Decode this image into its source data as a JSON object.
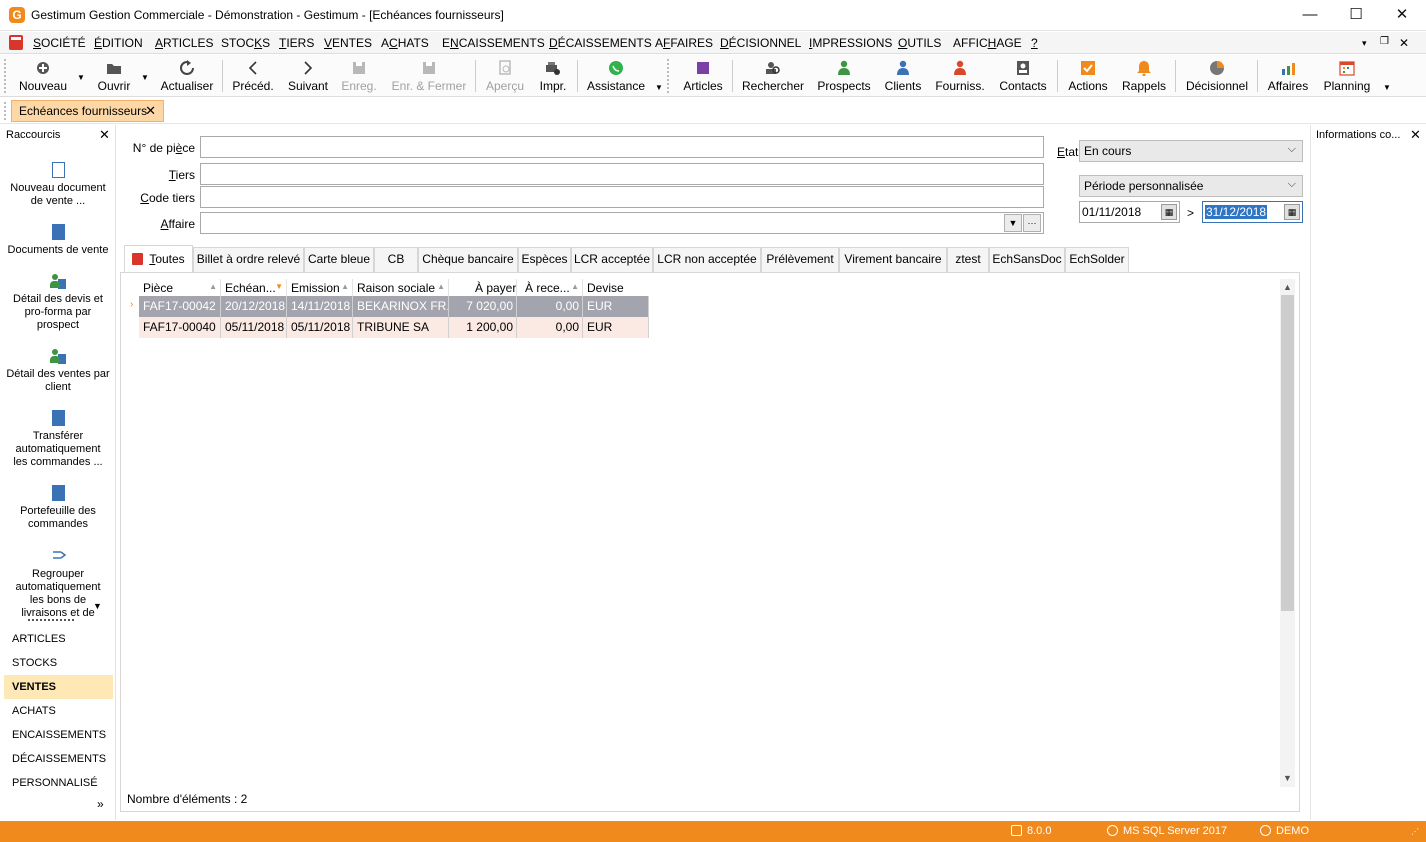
{
  "window": {
    "logo_letter": "G",
    "title": "Gestimum Gestion Commerciale - Démonstration - Gestimum - [Echéances fournisseurs]",
    "minimize": "—",
    "maximize": "☐",
    "close": "✕"
  },
  "menu": [
    {
      "pre": "",
      "u": "S",
      "post": "OCIÉTÉ"
    },
    {
      "pre": "",
      "u": "É",
      "post": "DITION"
    },
    {
      "pre": "",
      "u": "A",
      "post": "RTICLES"
    },
    {
      "pre": "STOC",
      "u": "K",
      "post": "S"
    },
    {
      "pre": "",
      "u": "T",
      "post": "IERS"
    },
    {
      "pre": "",
      "u": "V",
      "post": "ENTES"
    },
    {
      "pre": "A",
      "u": "C",
      "post": "HATS"
    },
    {
      "pre": "E",
      "u": "N",
      "post": "CAISSEMENTS"
    },
    {
      "pre": "",
      "u": "D",
      "post": "ÉCAISSEMENTS"
    },
    {
      "pre": "A",
      "u": "F",
      "post": "FAIRES"
    },
    {
      "pre": "",
      "u": "D",
      "post": "ÉCISIONNEL"
    },
    {
      "pre": "",
      "u": "I",
      "post": "MPRESSIONS"
    },
    {
      "pre": "",
      "u": "O",
      "post": "UTILS"
    },
    {
      "pre": "AFFIC",
      "u": "H",
      "post": "AGE"
    },
    {
      "pre": "",
      "u": "?",
      "post": ""
    }
  ],
  "toolbar": {
    "nouveau": "Nouveau",
    "ouvrir": "Ouvrir",
    "actualiser": "Actualiser",
    "preced": "Précéd.",
    "suivant": "Suivant",
    "enreg": "Enreg.",
    "enr_fermer": "Enr. & Fermer",
    "apercu": "Aperçu",
    "impr": "Impr.",
    "assistance": "Assistance",
    "articles": "Articles",
    "rechercher": "Rechercher",
    "prospects": "Prospects",
    "clients": "Clients",
    "fourniss": "Fourniss.",
    "contacts": "Contacts",
    "actions": "Actions",
    "rappels": "Rappels",
    "decisionnel": "Décisionnel",
    "affaires": "Affaires",
    "planning": "Planning"
  },
  "doc_tab": {
    "label": "Echéances fournisseurs",
    "close": "✕"
  },
  "sidebar": {
    "title": "Raccourcis",
    "close": "✕",
    "shortcuts": [
      "Nouveau document de vente ...",
      "Documents de vente",
      "Détail des devis et pro-forma par prospect",
      "Détail des ventes par client",
      "Transférer automatiquement les commandes ...",
      "Portefeuille des commandes",
      "Regrouper automatiquement les bons de livraisons et de"
    ],
    "categories": [
      "ARTICLES",
      "STOCKS",
      "VENTES",
      "ACHATS",
      "ENCAISSEMENTS",
      "DÉCAISSEMENTS",
      "PERSONNALISÉ"
    ],
    "active_category": "VENTES",
    "expand": "»"
  },
  "right_panel": {
    "title": "Informations co...",
    "close": "✕"
  },
  "form": {
    "num_piece_label": {
      "pre": "N° de pi",
      "u": "è",
      "post": "ce"
    },
    "tiers_label": {
      "pre": "",
      "u": "T",
      "post": "iers"
    },
    "code_tiers_label": {
      "pre": "",
      "u": "C",
      "post": "ode tiers"
    },
    "affaire_label": {
      "pre": "",
      "u": "A",
      "post": "ffaire"
    },
    "num_piece": "",
    "tiers": "",
    "code_tiers": "",
    "affaire": "",
    "etat_label": {
      "pre": "",
      "u": "E",
      "post": "tat"
    },
    "etat": "En cours",
    "periode": "Période personnalisée",
    "date_from": "01/11/2018",
    "date_sep": ">",
    "date_to": "31/12/2018"
  },
  "tabs": [
    {
      "pre": "",
      "u": "T",
      "post": "outes"
    },
    {
      "pre": "Billet à ordre relevé",
      "u": "",
      "post": ""
    },
    {
      "pre": "Carte bleue",
      "u": "",
      "post": ""
    },
    {
      "pre": "CB",
      "u": "",
      "post": ""
    },
    {
      "pre": "Chèque bancaire",
      "u": "",
      "post": ""
    },
    {
      "pre": "Espèces",
      "u": "",
      "post": ""
    },
    {
      "pre": "LCR acceptée",
      "u": "",
      "post": ""
    },
    {
      "pre": "LCR non acceptée",
      "u": "",
      "post": ""
    },
    {
      "pre": "Prélèvement",
      "u": "",
      "post": ""
    },
    {
      "pre": "Virement bancaire",
      "u": "",
      "post": ""
    },
    {
      "pre": "ztest",
      "u": "",
      "post": ""
    },
    {
      "pre": "EchSansDoc",
      "u": "",
      "post": ""
    },
    {
      "pre": "EchSolder",
      "u": "",
      "post": ""
    }
  ],
  "grid": {
    "columns": [
      "Pièce",
      "Echéan...",
      "Emission",
      "Raison sociale",
      "À payer",
      "À rece...",
      "Devise"
    ],
    "rows": [
      [
        "FAF17-00042",
        "20/12/2018",
        "14/11/2018",
        "BEKARINOX FR...",
        "7 020,00",
        "0,00",
        "EUR"
      ],
      [
        "FAF17-00040",
        "05/11/2018",
        "05/11/2018",
        "TRIBUNE SA",
        "1 200,00",
        "0,00",
        "EUR"
      ]
    ],
    "count_label": "Nombre d'éléments : 2"
  },
  "status": {
    "version": "8.0.0",
    "server": "MS SQL Server 2017",
    "user": "DEMO"
  },
  "colors": {
    "accent": "#f08a1c",
    "selected_row": "#a4a4ae",
    "alt_row": "#fbe9e4",
    "active_category": "#fde8b6"
  }
}
